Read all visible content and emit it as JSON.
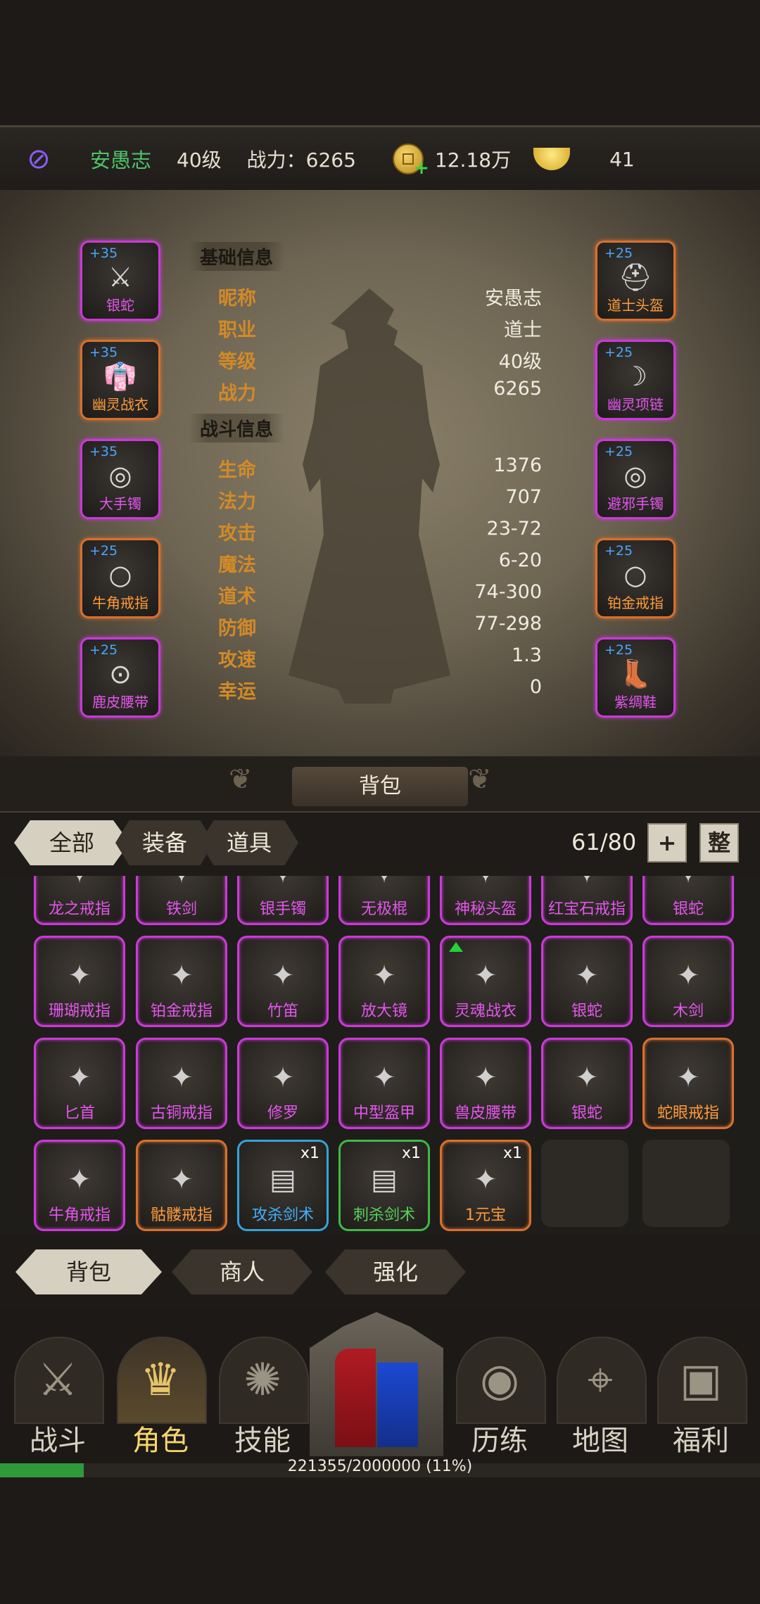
{
  "header": {
    "player_name": "安愚志",
    "level": "40级",
    "power": "战力：6265",
    "coins": "12.18万",
    "gold": "41"
  },
  "character": {
    "basic_title": "基础信息",
    "basic": [
      {
        "k": "昵称",
        "v": "安愚志"
      },
      {
        "k": "职业",
        "v": "道士"
      },
      {
        "k": "等级",
        "v": "40级"
      },
      {
        "k": "战力",
        "v": "6265"
      }
    ],
    "battle_title": "战斗信息",
    "battle": [
      {
        "k": "生命",
        "v": "1376"
      },
      {
        "k": "法力",
        "v": "707"
      },
      {
        "k": "攻击",
        "v": "23-72"
      },
      {
        "k": "魔法",
        "v": "6-20"
      },
      {
        "k": "道术",
        "v": "74-300"
      },
      {
        "k": "防御",
        "v": "77-298"
      },
      {
        "k": "攻速",
        "v": "1.3"
      },
      {
        "k": "幸运",
        "v": "0"
      }
    ],
    "left_equip": [
      {
        "plus": "+35",
        "label": "银蛇",
        "rarity": "purple",
        "icon": "sword-icon"
      },
      {
        "plus": "+35",
        "label": "幽灵战衣",
        "rarity": "orange",
        "icon": "robe-icon"
      },
      {
        "plus": "+35",
        "label": "大手镯",
        "rarity": "purple",
        "icon": "bracelet-icon"
      },
      {
        "plus": "+25",
        "label": "牛角戒指",
        "rarity": "orange",
        "icon": "ring-icon"
      },
      {
        "plus": "+25",
        "label": "鹿皮腰带",
        "rarity": "purple",
        "icon": "belt-icon"
      }
    ],
    "right_equip": [
      {
        "plus": "+25",
        "label": "道士头盔",
        "rarity": "orange",
        "icon": "helmet-icon"
      },
      {
        "plus": "+25",
        "label": "幽灵项链",
        "rarity": "purple",
        "icon": "necklace-icon"
      },
      {
        "plus": "+25",
        "label": "避邪手镯",
        "rarity": "purple",
        "icon": "bracelet-icon"
      },
      {
        "plus": "+25",
        "label": "铂金戒指",
        "rarity": "orange",
        "icon": "ring-icon"
      },
      {
        "plus": "+25",
        "label": "紫绸鞋",
        "rarity": "purple",
        "icon": "boots-icon"
      }
    ]
  },
  "bag": {
    "title": "背包",
    "tabs": [
      "全部",
      "装备",
      "道具"
    ],
    "count": "61/80",
    "add_label": "+",
    "sort_label": "整",
    "rows": [
      [
        {
          "label": "龙之戒指",
          "rarity": "purple"
        },
        {
          "label": "铁剑",
          "rarity": "purple"
        },
        {
          "label": "银手镯",
          "rarity": "purple"
        },
        {
          "label": "无极棍",
          "rarity": "purple"
        },
        {
          "label": "神秘头盔",
          "rarity": "purple"
        },
        {
          "label": "红宝石戒指",
          "rarity": "purple"
        },
        {
          "label": "银蛇",
          "rarity": "purple"
        }
      ],
      [
        {
          "label": "珊瑚戒指",
          "rarity": "purple"
        },
        {
          "label": "铂金戒指",
          "rarity": "purple"
        },
        {
          "label": "竹笛",
          "rarity": "purple"
        },
        {
          "label": "放大镜",
          "rarity": "purple"
        },
        {
          "label": "灵魂战衣",
          "rarity": "purple",
          "up": true
        },
        {
          "label": "银蛇",
          "rarity": "purple"
        },
        {
          "label": "木剑",
          "rarity": "purple"
        }
      ],
      [
        {
          "label": "匕首",
          "rarity": "purple"
        },
        {
          "label": "古铜戒指",
          "rarity": "purple"
        },
        {
          "label": "修罗",
          "rarity": "purple"
        },
        {
          "label": "中型盔甲",
          "rarity": "purple"
        },
        {
          "label": "兽皮腰带",
          "rarity": "purple"
        },
        {
          "label": "银蛇",
          "rarity": "purple"
        },
        {
          "label": "蛇眼戒指",
          "rarity": "orange"
        }
      ],
      [
        {
          "label": "牛角戒指",
          "rarity": "purple"
        },
        {
          "label": "骷髅戒指",
          "rarity": "orange"
        },
        {
          "label": "攻杀剑术",
          "rarity": "blue",
          "qty": "x1"
        },
        {
          "label": "刺杀剑术",
          "rarity": "green",
          "qty": "x1"
        },
        {
          "label": "1元宝",
          "rarity": "orange",
          "qty": "x1"
        },
        {
          "label": "",
          "rarity": "empty"
        },
        {
          "label": "",
          "rarity": "empty"
        }
      ]
    ]
  },
  "lower_tabs": [
    "背包",
    "商人",
    "强化"
  ],
  "nav": [
    "战斗",
    "角色",
    "技能",
    "历练",
    "地图",
    "福利"
  ],
  "xp": {
    "text": "221355/2000000 (11%)",
    "fraction": 0.11
  }
}
